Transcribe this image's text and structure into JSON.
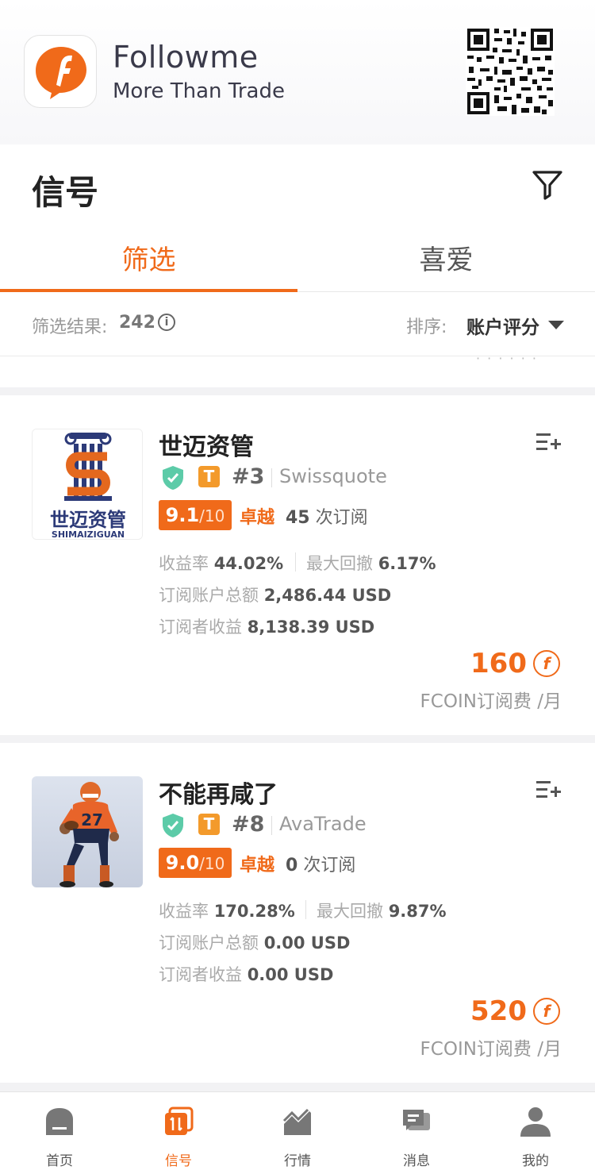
{
  "banner": {
    "app_name": "Followme",
    "slogan": "More Than Trade"
  },
  "header": {
    "title": "信号",
    "tabs": [
      {
        "label": "筛选",
        "active": true
      },
      {
        "label": "喜爱",
        "active": false
      }
    ],
    "result_label": "筛选结果:",
    "result_count": "242",
    "sort_label": "排序:",
    "sort_value": "账户评分"
  },
  "signals": [
    {
      "name": "世迈资管",
      "rank": "#3",
      "broker": "Swissquote",
      "score": "9.1",
      "score_den": "/10",
      "grade": "卓越",
      "subs_count": "45",
      "subs_label": "次订阅",
      "return_label": "收益率",
      "return_value": "44.02%",
      "drawdown_label": "最大回撤",
      "drawdown_value": "6.17%",
      "total_label": "订阅账户总额",
      "total_value": "2,486.44 USD",
      "profit_label": "订阅者收益",
      "profit_value": "8,138.39 USD",
      "price": "160",
      "fee_label": "FCOIN订阅费 /月",
      "avatar_text": "世迈资管",
      "avatar_subtext": "SHIMAIZIGUAN"
    },
    {
      "name": "不能再咸了",
      "rank": "#8",
      "broker": "AvaTrade",
      "score": "9.0",
      "score_den": "/10",
      "grade": "卓越",
      "subs_count": "0",
      "subs_label": "次订阅",
      "return_label": "收益率",
      "return_value": "170.28%",
      "drawdown_label": "最大回撤",
      "drawdown_value": "9.87%",
      "total_label": "订阅账户总额",
      "total_value": "0.00 USD",
      "profit_label": "订阅者收益",
      "profit_value": "0.00 USD",
      "price": "520",
      "fee_label": "FCOIN订阅费 /月"
    }
  ],
  "bottom_nav": [
    {
      "label": "首页",
      "icon": "home-icon",
      "active": false
    },
    {
      "label": "信号",
      "icon": "signal-icon",
      "active": true
    },
    {
      "label": "行情",
      "icon": "market-icon",
      "active": false
    },
    {
      "label": "消息",
      "icon": "message-icon",
      "active": false
    },
    {
      "label": "我的",
      "icon": "profile-icon",
      "active": false
    }
  ],
  "colors": {
    "accent": "#f06a1a",
    "badge": "#f39a2b",
    "shield": "#5ccba8"
  }
}
